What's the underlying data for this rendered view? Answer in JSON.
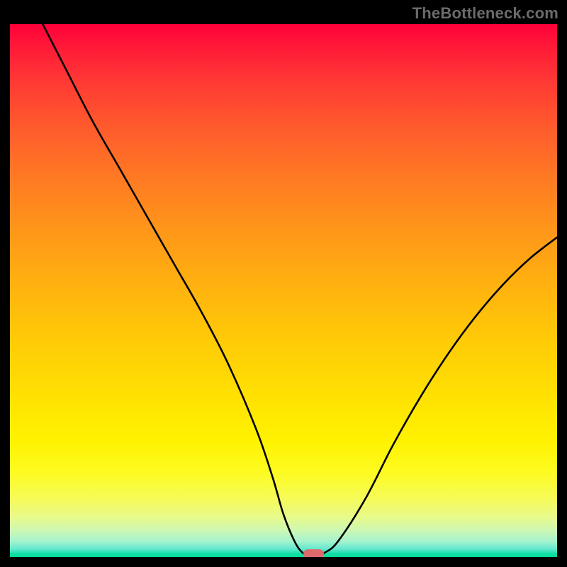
{
  "watermark": "TheBottleneck.com",
  "chart_data": {
    "type": "line",
    "title": "",
    "xlabel": "",
    "ylabel": "",
    "xlim": [
      0,
      100
    ],
    "ylim": [
      0,
      100
    ],
    "grid": false,
    "legend": false,
    "series": [
      {
        "name": "bottleneck-curve",
        "x": [
          6,
          10,
          15,
          20,
          25,
          30,
          35,
          40,
          45,
          48,
          50,
          52,
          53.5,
          55,
          56,
          57.5,
          60,
          65,
          70,
          75,
          80,
          85,
          90,
          95,
          100
        ],
        "y": [
          100,
          92,
          82,
          73,
          64,
          55,
          46,
          36,
          24,
          15,
          8,
          3,
          0.8,
          0,
          0,
          0.8,
          3,
          11,
          21,
          30,
          38,
          45,
          51,
          56,
          60
        ]
      }
    ],
    "marker": {
      "name": "optimal-range",
      "x_center": 55.5,
      "width_pct": 3.8,
      "y": 0,
      "color": "#dd6a6d"
    },
    "background_gradient": {
      "top": "#ff003a",
      "mid": "#ffee00",
      "bottom": "#00db93"
    }
  }
}
